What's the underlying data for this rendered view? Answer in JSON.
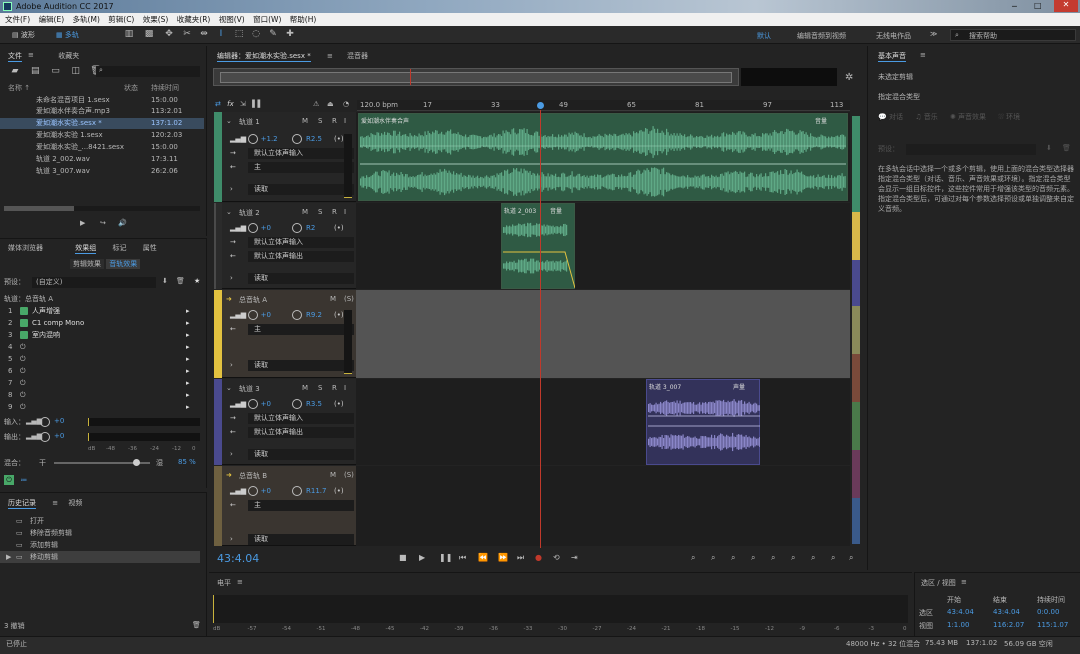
{
  "window": {
    "title": "Adobe Audition CC 2017"
  },
  "menu": [
    "文件(F)",
    "编辑(E)",
    "多轨(M)",
    "剪辑(C)",
    "效果(S)",
    "收藏夹(R)",
    "视图(V)",
    "窗口(W)",
    "帮助(H)"
  ],
  "toolbar": {
    "waveform_label": "波形",
    "multitrack_label": "多轨",
    "workspaces": [
      "默认",
      "编辑音频到视频",
      "无线电作品"
    ],
    "search_placeholder": "搜索帮助"
  },
  "files_panel": {
    "tabs": [
      "文件",
      "收藏夹"
    ],
    "columns": {
      "name": "名称 ↑",
      "status": "状态",
      "duration": "持续时间"
    },
    "rows": [
      {
        "name": "未命名混音项目 1.sesx",
        "status": "",
        "duration": "15:0.00"
      },
      {
        "name": "爱如潮水伴奏合声.mp3",
        "status": "",
        "duration": "113:2.01"
      },
      {
        "name": "爱如潮水实验.sesx *",
        "status": "",
        "duration": "137:1.02"
      },
      {
        "name": "爱如潮水实验 1.sesx",
        "status": "",
        "duration": "120:2.03"
      },
      {
        "name": "爱如潮水实验_...8421.sesx",
        "status": "",
        "duration": "15:0.00"
      },
      {
        "name": "轨道 2_002.wav",
        "status": "",
        "duration": "17:3.11"
      },
      {
        "name": "轨道 3_007.wav",
        "status": "",
        "duration": "26:2.06"
      }
    ]
  },
  "effects_panel": {
    "tabs": [
      "媒体浏览器",
      "效果组",
      "标记",
      "属性"
    ],
    "subtabs": [
      "剪辑效果",
      "音轨效果"
    ],
    "preset_label": "预设：",
    "preset_value": "(自定义)",
    "track_label": "轨道：总音轨 A",
    "rows": [
      {
        "num": "1",
        "name": "人声增强"
      },
      {
        "num": "2",
        "name": "C1 comp Mono"
      },
      {
        "num": "3",
        "name": "室内混响"
      },
      {
        "num": "4",
        "name": ""
      },
      {
        "num": "5",
        "name": ""
      },
      {
        "num": "6",
        "name": ""
      },
      {
        "num": "7",
        "name": ""
      },
      {
        "num": "8",
        "name": ""
      },
      {
        "num": "9",
        "name": ""
      }
    ],
    "input_label": "输入：",
    "input_val": "+0",
    "output_label": "输出：",
    "output_val": "+0",
    "meter_ticks": [
      "dB",
      "-48",
      "-36",
      "-24",
      "-12",
      "0"
    ],
    "mix_label": "混合：",
    "mix_dry": "干",
    "mix_wet": "湿",
    "mix_value": "85 %",
    "mix_level": 0.85
  },
  "history_panel": {
    "tabs": [
      "历史记录",
      "视频"
    ],
    "items": [
      "打开",
      "移除音频剪辑",
      "添加剪辑",
      "移动剪辑"
    ],
    "undo_count": "3 撤销"
  },
  "status_bar": {
    "left": "已停止",
    "sample": "48000 Hz • 32 位混合",
    "size": "75.43 MB",
    "duration": "137:1.02",
    "free": "56.09 GB 空闲"
  },
  "editor": {
    "tabs": [
      "编辑器：爱如潮水实验.sesx *",
      "混音器"
    ],
    "bpm": "120.0 bpm",
    "ruler": [
      "17",
      "33",
      "49",
      "65",
      "81",
      "97",
      "113"
    ],
    "time": "43:4.04",
    "tracks": [
      {
        "name": "轨道 1",
        "vol": "+1.2",
        "pan": "R2.5",
        "input": "默认立体声输入",
        "output": "主",
        "mode": "读取",
        "color": "#3f8c6a"
      },
      {
        "name": "轨道 2",
        "vol": "+0",
        "pan": "R2",
        "input": "默认立体声输入",
        "output": "默认立体声输出",
        "mode": "读取",
        "color": "#d9b84a"
      },
      {
        "name": "总音轨 A",
        "vol": "+0",
        "pan": "R9.2",
        "input": "",
        "output": "主",
        "mode": "读取",
        "color": "#e3c240"
      },
      {
        "name": "轨道 3",
        "vol": "+0",
        "pan": "R3.5",
        "input": "默认立体声输入",
        "output": "默认立体声输出",
        "mode": "读取",
        "color": "#4a4a8e"
      },
      {
        "name": "总音轨 B",
        "vol": "+0",
        "pan": "R11.7",
        "input": "",
        "output": "主",
        "mode": "读取",
        "color": "#6e6040"
      }
    ],
    "clips": [
      {
        "name": "爱如潮水伴奏合声",
        "vol": "音量"
      },
      {
        "name": "轨道 2_003",
        "vol": "音量"
      },
      {
        "name": "轨道 3_007",
        "vol": "声量"
      }
    ]
  },
  "level_panel": {
    "title": "电平",
    "ticks": [
      "dB",
      "-57",
      "-54",
      "-51",
      "-48",
      "-45",
      "-42",
      "-39",
      "-36",
      "-33",
      "-30",
      "-27",
      "-24",
      "-21",
      "-18",
      "-15",
      "-12",
      "-9",
      "-6",
      "-3",
      "0"
    ]
  },
  "selection_panel": {
    "title": "选区 / 视图",
    "headers": [
      "开始",
      "结束",
      "持续时间"
    ],
    "rows": [
      {
        "label": "选区",
        "start": "43:4.04",
        "end": "43:4.04",
        "dur": "0:0.00"
      },
      {
        "label": "视图",
        "start": "1:1.00",
        "end": "116:2.07",
        "dur": "115:1.07"
      }
    ]
  },
  "essential_sound": {
    "title": "基本声音",
    "no_clip": "未选定剪辑",
    "assign_label": "指定混合类型",
    "types": [
      "对话",
      "音乐",
      "声音效果",
      "环境"
    ],
    "preset_label": "预设：",
    "desc": "在多轨会话中选择一个或多个剪辑，使用上面的混合类型选择器指定混合类型（对话、音乐、声音效果或环境）。指定混合类型会显示一组目标控件，这些控件常用于增强该类型的音频元素。指定混合类型后，可通过对每个参数选择预设或单独调整来自定义音频。"
  },
  "colors": {
    "accent": "#4b9be3",
    "playhead": "#c0392b",
    "wave_green": "#5fa986",
    "wave_purple": "#8a86c8"
  }
}
